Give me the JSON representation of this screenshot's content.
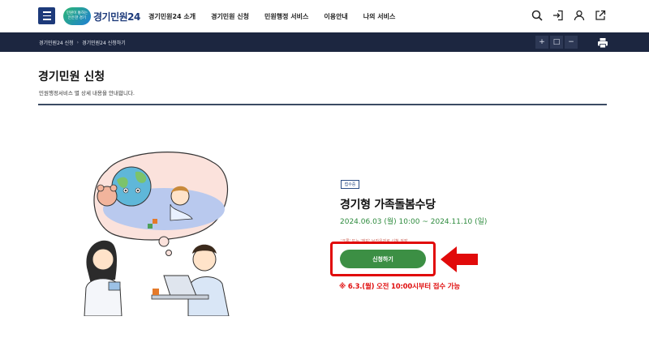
{
  "header": {
    "menu_icon": "hamburger-menu-icon",
    "logo_badge": "민원이 통하는 든든한 경기",
    "logo_text": "경기민원24",
    "nav": [
      "경기민원24 소개",
      "경기민원 신청",
      "민원행정 서비스",
      "이용안내",
      "나의 서비스"
    ],
    "utility_icons": [
      "search-icon",
      "login-icon",
      "user-icon",
      "external-link-icon"
    ]
  },
  "subbar": {
    "breadcrumb": [
      "경기민원24 신청",
      "경기민원24 신청하기"
    ],
    "zoom_buttons": [
      "+",
      "□",
      "−"
    ],
    "print_icon": "print-icon",
    "background": "#1c2640"
  },
  "page": {
    "title": "경기민원 신청",
    "description": "민원행정서비스 별 상세 내용을 안내합니다."
  },
  "service": {
    "status": "접수중",
    "name": "경기형 가족돌봄수당",
    "period": "2024.06.03 (월) 10:00 ~ 2024.11.10 (일)",
    "notice": "'크롬' 또는 '엣지' 브라우저로 신청 권장",
    "apply_label": "신청하기",
    "apply_note": "※ 6.3.(월) 오전 10:00시부터 접수 가능",
    "accent_green": "#3c8f44",
    "highlight_red": "#e10a0a"
  }
}
